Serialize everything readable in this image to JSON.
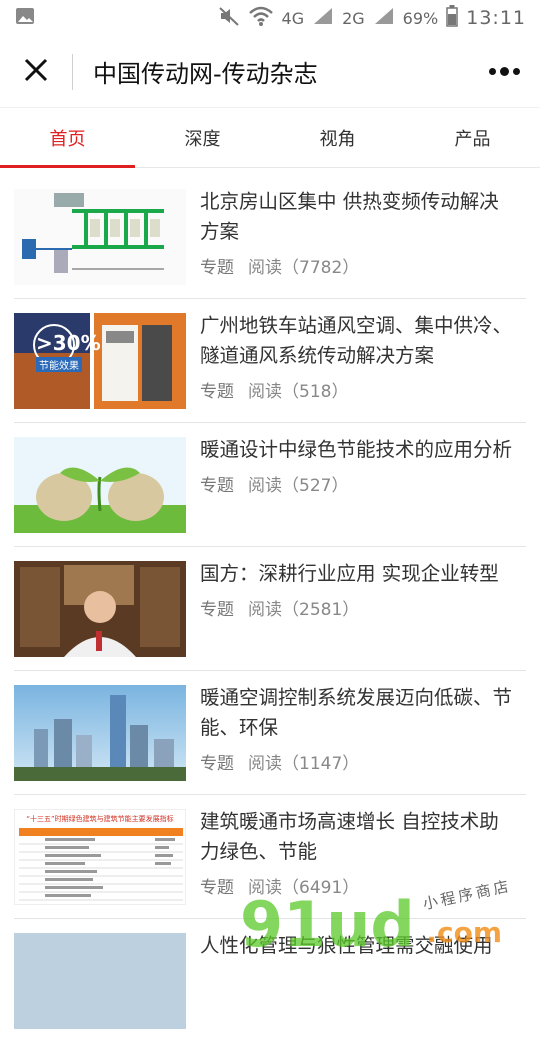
{
  "status": {
    "signal_a": "4G",
    "signal_b": "4G",
    "signal_c": "2G",
    "battery": "69%",
    "time": "13:11"
  },
  "header": {
    "title": "中国传动网-传动杂志"
  },
  "tabs": [
    {
      "label": "首页"
    },
    {
      "label": "深度"
    },
    {
      "label": "视角"
    },
    {
      "label": "产品"
    }
  ],
  "articles": [
    {
      "title_line1": "北京房山区集中 供热变频传动解决",
      "title_line2": "方案",
      "tag": "专题",
      "reads": "阅读（7782）"
    },
    {
      "title_line1": "广州地铁车站通风空调、集中供冷、",
      "title_line2": "隧道通风系统传动解决方案",
      "tag": "专题",
      "reads": "阅读（518）",
      "thumb_text": ">30%",
      "thumb_caption": "节能效果"
    },
    {
      "title_line1": "暖通设计中绿色节能技术的应用分析",
      "title_line2": "",
      "tag": "专题",
      "reads": "阅读（527）"
    },
    {
      "title_line1": "国方：深耕行业应用 实现企业转型",
      "title_line2": "",
      "tag": "专题",
      "reads": "阅读（2581）"
    },
    {
      "title_line1": "暖通空调控制系统发展迈向低碳、节",
      "title_line2": "能、环保",
      "tag": "专题",
      "reads": "阅读（1147）"
    },
    {
      "title_line1": "建筑暖通市场高速增长 自控技术助",
      "title_line2": "力绿色、节能",
      "tag": "专题",
      "reads": "阅读（6491）",
      "thumb_text": "“十三五”时期绿色建筑与建筑节能主要发展指标"
    },
    {
      "title_line1": "人性化管理与狼性管理需交融使用",
      "title_line2": "",
      "tag": "",
      "reads": ""
    }
  ],
  "watermark": {
    "text": "小程序商店",
    "brand": "91ud",
    "domain": ".com"
  },
  "colors": {
    "accent": "#e02020"
  }
}
